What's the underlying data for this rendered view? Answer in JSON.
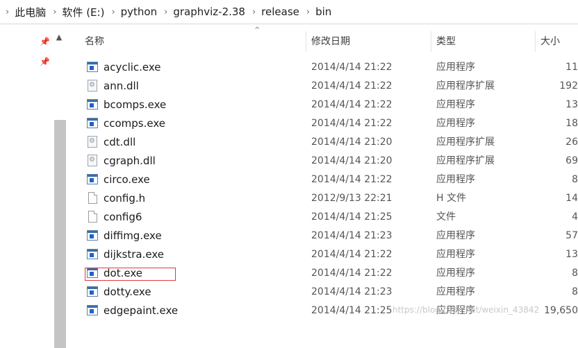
{
  "breadcrumb": [
    "此电脑",
    "软件 (E:)",
    "python",
    "graphviz-2.38",
    "release",
    "bin"
  ],
  "columns": {
    "name": "名称",
    "date": "修改日期",
    "type": "类型",
    "size": "大小"
  },
  "files": [
    {
      "name": "acyclic.exe",
      "date": "2014/4/14 21:22",
      "type": "应用程序",
      "size": "11",
      "icon": "exe"
    },
    {
      "name": "ann.dll",
      "date": "2014/4/14 21:22",
      "type": "应用程序扩展",
      "size": "192",
      "icon": "dll"
    },
    {
      "name": "bcomps.exe",
      "date": "2014/4/14 21:22",
      "type": "应用程序",
      "size": "13",
      "icon": "exe"
    },
    {
      "name": "ccomps.exe",
      "date": "2014/4/14 21:22",
      "type": "应用程序",
      "size": "18",
      "icon": "exe"
    },
    {
      "name": "cdt.dll",
      "date": "2014/4/14 21:20",
      "type": "应用程序扩展",
      "size": "26",
      "icon": "dll"
    },
    {
      "name": "cgraph.dll",
      "date": "2014/4/14 21:20",
      "type": "应用程序扩展",
      "size": "69",
      "icon": "dll"
    },
    {
      "name": "circo.exe",
      "date": "2014/4/14 21:22",
      "type": "应用程序",
      "size": "8",
      "icon": "exe"
    },
    {
      "name": "config.h",
      "date": "2012/9/13 22:21",
      "type": "H 文件",
      "size": "14",
      "icon": "file"
    },
    {
      "name": "config6",
      "date": "2014/4/14 21:25",
      "type": "文件",
      "size": "4",
      "icon": "file"
    },
    {
      "name": "diffimg.exe",
      "date": "2014/4/14 21:23",
      "type": "应用程序",
      "size": "57",
      "icon": "exe"
    },
    {
      "name": "dijkstra.exe",
      "date": "2014/4/14 21:22",
      "type": "应用程序",
      "size": "13",
      "icon": "exe"
    },
    {
      "name": "dot.exe",
      "date": "2014/4/14 21:22",
      "type": "应用程序",
      "size": "8",
      "icon": "exe"
    },
    {
      "name": "dotty.exe",
      "date": "2014/4/14 21:23",
      "type": "应用程序",
      "size": "8",
      "icon": "exe"
    },
    {
      "name": "edgepaint.exe",
      "date": "2014/4/14 21:25",
      "type": "应用程序",
      "size": "19,650",
      "icon": "exe"
    }
  ],
  "watermark": "https://blog.csdn.net/weixin_43842",
  "icons": {
    "breadcrumb_separator": "chevron-right-icon",
    "pin": "pin-icon",
    "nav_expand": "chevron-up-icon",
    "sort": "sort-ascending-icon"
  },
  "colors": {
    "highlight_border": "#e0393e"
  }
}
